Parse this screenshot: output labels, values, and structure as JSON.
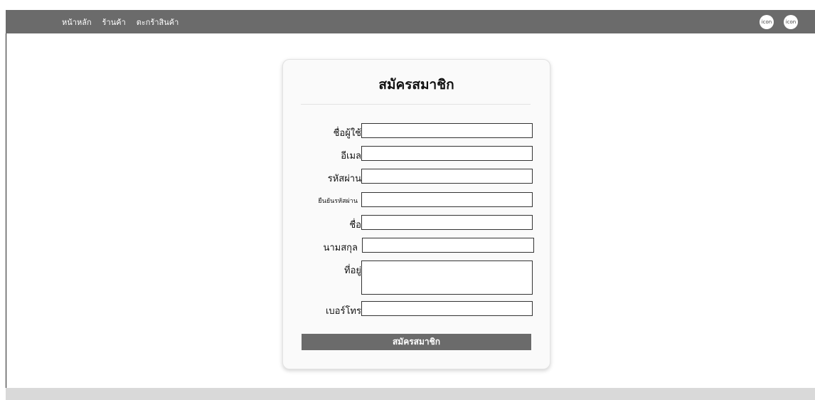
{
  "nav": {
    "links": [
      "หน้าหลัก",
      "ร้านค้า",
      "ตะกร้าสินค้า"
    ],
    "icons": [
      "icon",
      "icon"
    ]
  },
  "form": {
    "title": "สมัครสมาชิก",
    "labels": {
      "username": "ชื่อผู้ใช้",
      "email": "อีเมล",
      "password": "รหัสผ่าน",
      "confirm_password": "ยืนยันรหัสผ่าน",
      "first_name": "ชื่อ",
      "last_name": "นามสกุล",
      "address": "ที่อยู่",
      "phone": "เบอร์โทร"
    },
    "submit_label": "สมัครสมาชิก"
  },
  "colors": {
    "navbar": "#6b6b6b",
    "button": "#6b6b6b",
    "footer": "#d9d9d9"
  }
}
